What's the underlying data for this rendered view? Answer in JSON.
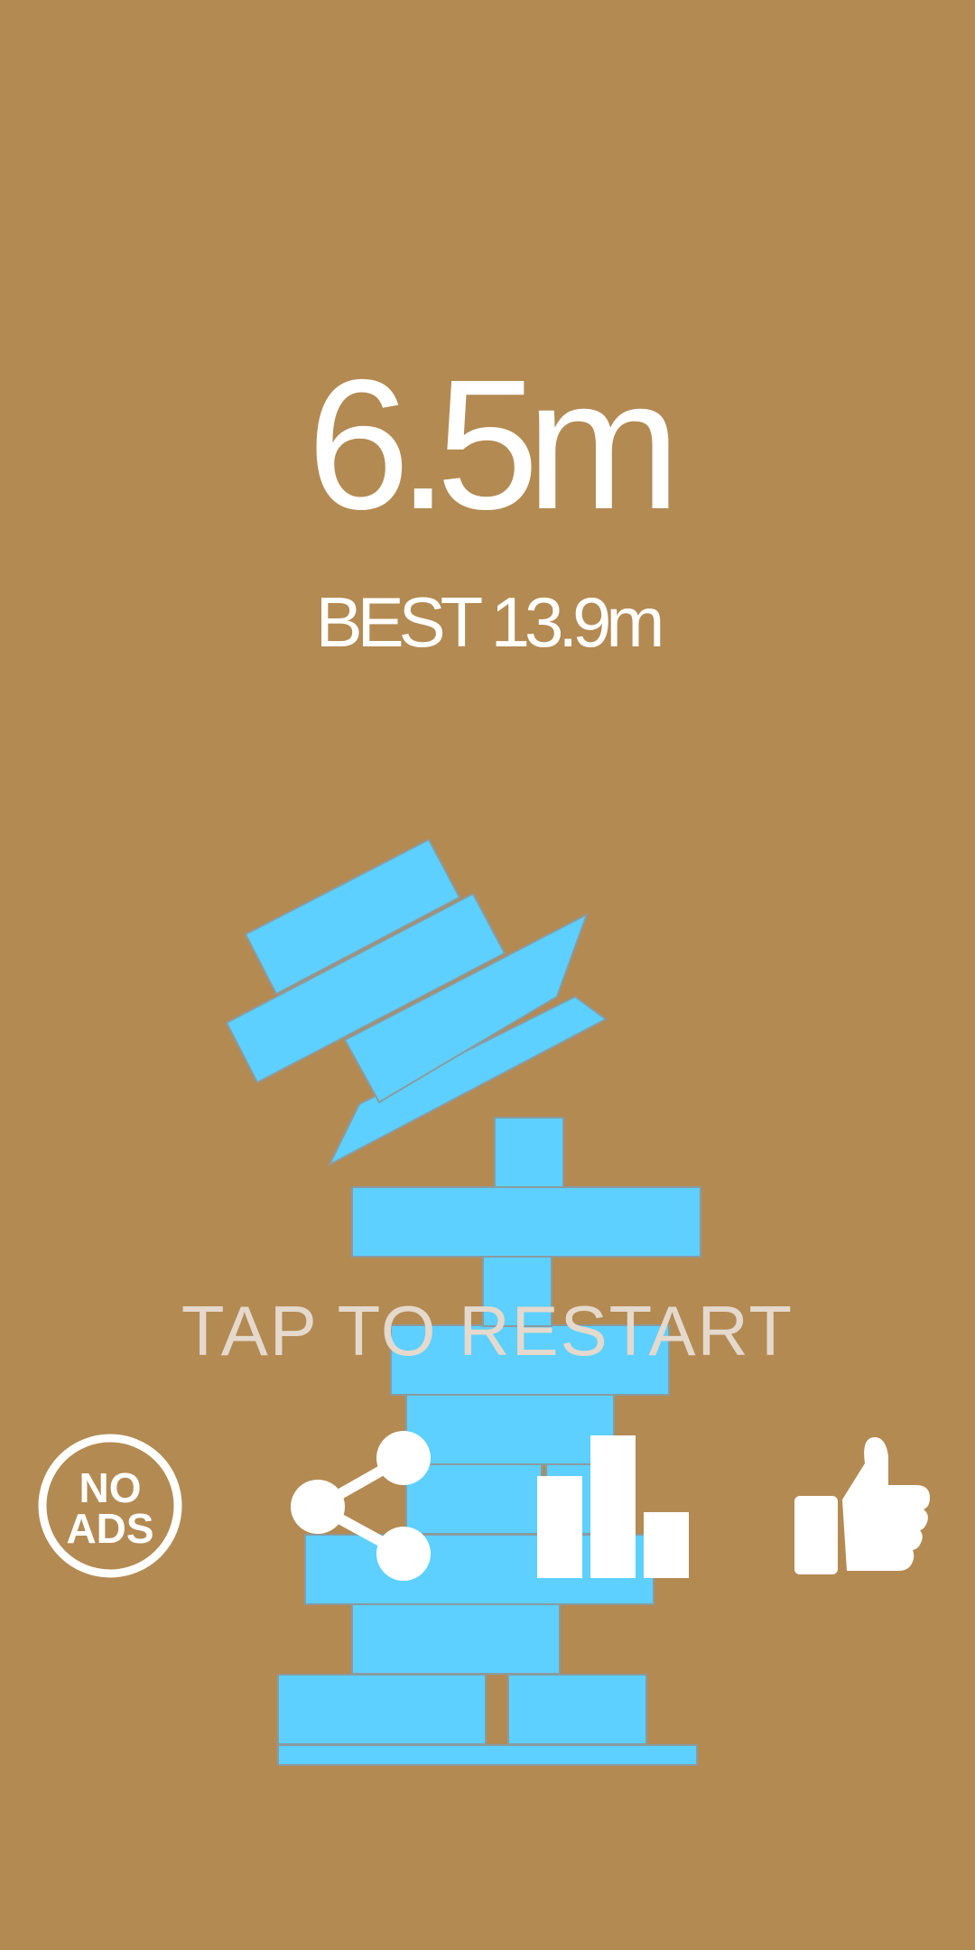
{
  "score": {
    "current": "6.5m",
    "best": "BEST 13.9m"
  },
  "restart_label": "TAP TO RESTART",
  "buttons": {
    "no_ads": {
      "line1": "NO",
      "line2": "ADS"
    }
  },
  "colors": {
    "background": "#B38A52",
    "block": "#5DD0FF",
    "block_seam": "#8A9BA0",
    "text": "#FFFFFF",
    "restart_text": "#E4D9CC"
  },
  "icons": [
    "no-ads-icon",
    "share-icon",
    "leaderboard-icon",
    "thumbs-up-icon"
  ]
}
